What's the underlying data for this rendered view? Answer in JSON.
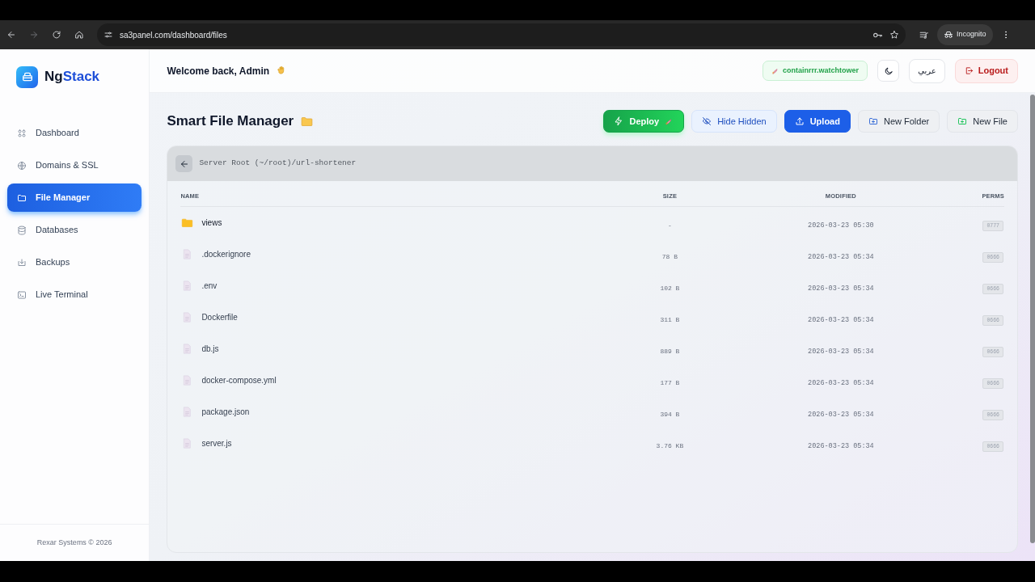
{
  "browser": {
    "url": "sa3panel.com/dashboard/files",
    "profile": "Incognito"
  },
  "brand": {
    "part_1": "Ng",
    "part_2": "Stack"
  },
  "sidebar": {
    "items": [
      {
        "label": "Dashboard",
        "kind": "grid",
        "selected": false
      },
      {
        "label": "Domains & SSL",
        "kind": "globe",
        "selected": false
      },
      {
        "label": "File Manager",
        "kind": "folder",
        "selected": true
      },
      {
        "label": "Databases",
        "kind": "database",
        "selected": false
      },
      {
        "label": "Backups",
        "kind": "download",
        "selected": false
      },
      {
        "label": "Live Terminal",
        "kind": "terminal",
        "selected": false
      }
    ],
    "footer": "Rexar Systems © 2026"
  },
  "header": {
    "greeting": "Welcome back, Admin",
    "container_badge": "containrrr.watchtower",
    "language": "عربي",
    "logout": "Logout"
  },
  "page": {
    "title": "Smart File Manager",
    "actions": [
      {
        "label": "Deploy",
        "kind": "deploy"
      },
      {
        "label": "Hide Hidden",
        "kind": "hide"
      },
      {
        "label": "Upload",
        "kind": "upload"
      },
      {
        "label": "New Folder",
        "kind": "folder"
      },
      {
        "label": "New File",
        "kind": "file"
      }
    ]
  },
  "file_table": {
    "path": "Server Root (~/root)/url-shortener",
    "columns": [
      "NAME",
      "SIZE",
      "MODIFIED",
      "PERMS"
    ],
    "rows": [
      {
        "kind": "folder",
        "name": "views",
        "size": "-",
        "modified": "2026-03-23 05:30",
        "perms": "0777"
      },
      {
        "kind": "file",
        "name": ".dockerignore",
        "size": "78 B",
        "modified": "2026-03-23 05:34",
        "perms": "0666"
      },
      {
        "kind": "file",
        "name": ".env",
        "size": "102 B",
        "modified": "2026-03-23 05:34",
        "perms": "0666"
      },
      {
        "kind": "file",
        "name": "Dockerfile",
        "size": "311 B",
        "modified": "2026-03-23 05:34",
        "perms": "0666"
      },
      {
        "kind": "file",
        "name": "db.js",
        "size": "889 B",
        "modified": "2026-03-23 05:34",
        "perms": "0666"
      },
      {
        "kind": "file",
        "name": "docker-compose.yml",
        "size": "177 B",
        "modified": "2026-03-23 05:34",
        "perms": "0666"
      },
      {
        "kind": "file",
        "name": "package.json",
        "size": "394 B",
        "modified": "2026-03-23 05:34",
        "perms": "0666"
      },
      {
        "kind": "file",
        "name": "server.js",
        "size": "3.76 KB",
        "modified": "2026-03-23 05:34",
        "perms": "0666"
      }
    ]
  }
}
